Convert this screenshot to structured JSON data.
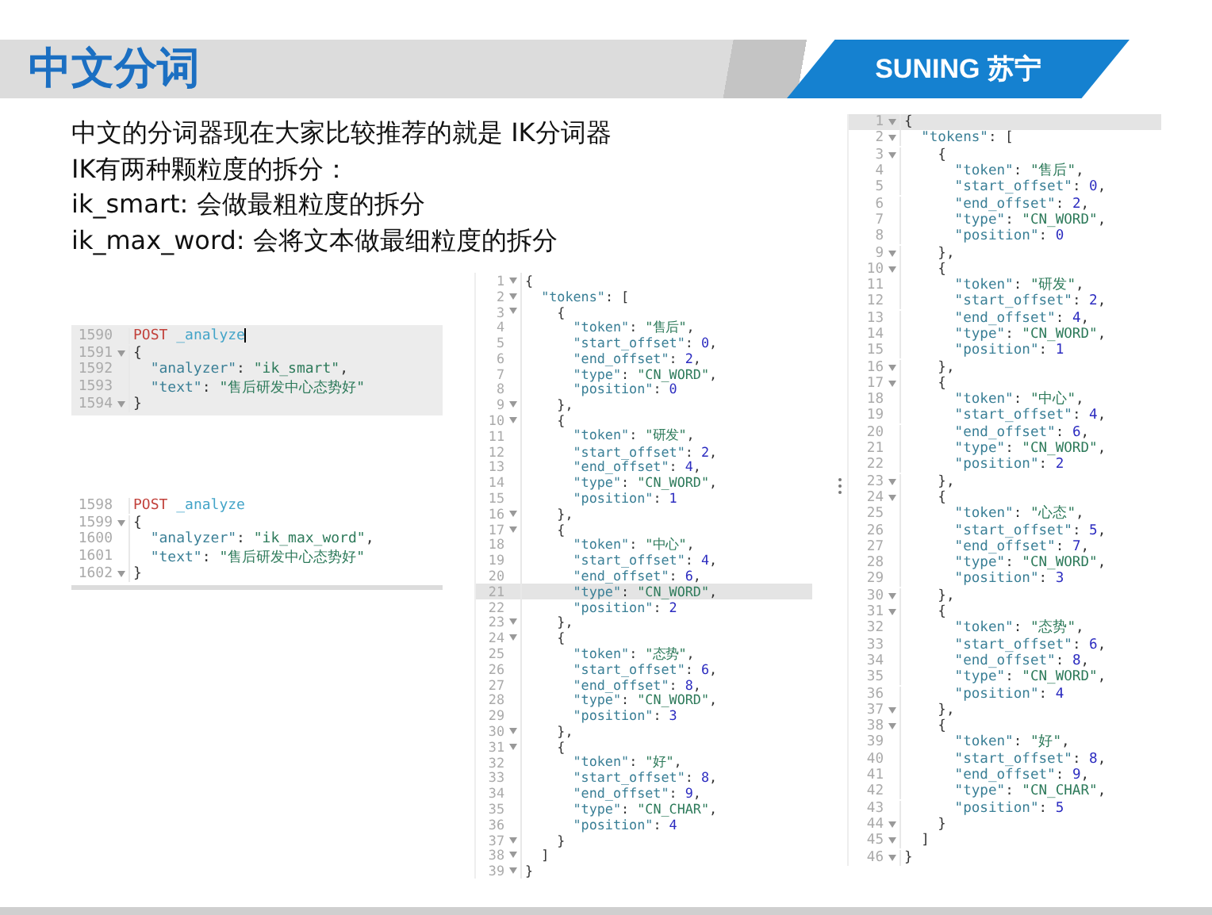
{
  "header": {
    "title": "中文分词",
    "logo": "SUNING 苏宁"
  },
  "intro": [
    "中文的分词器现在大家比较推荐的就是 IK分词器",
    "IK有两种颗粒度的拆分：",
    "ik_smart: 会做最粗粒度的拆分",
    "ik_max_word: 会将文本做最细粒度的拆分"
  ],
  "requests": [
    {
      "selected": true,
      "lines": [
        {
          "number": "1590",
          "text": "POST _analyze",
          "fold": false,
          "cursor": true
        },
        {
          "number": "1591",
          "text": "{",
          "fold": true,
          "cursor": false
        },
        {
          "number": "1592",
          "text": "  \"analyzer\": \"ik_smart\",",
          "fold": false,
          "cursor": false
        },
        {
          "number": "1593",
          "text": "  \"text\": \"售后研发中心态势好\"",
          "fold": false,
          "cursor": false
        },
        {
          "number": "1594",
          "text": "}",
          "fold": true,
          "cursor": false
        }
      ]
    },
    {
      "selected": false,
      "lines": [
        {
          "number": "1598",
          "text": "POST _analyze",
          "fold": false,
          "cursor": false
        },
        {
          "number": "1599",
          "text": "{",
          "fold": true,
          "cursor": false
        },
        {
          "number": "1600",
          "text": "  \"analyzer\": \"ik_max_word\",",
          "fold": false,
          "cursor": false
        },
        {
          "number": "1601",
          "text": "  \"text\": \"售后研发中心态势好\"",
          "fold": false,
          "cursor": false
        },
        {
          "number": "1602",
          "text": "}",
          "fold": true,
          "cursor": false
        }
      ]
    }
  ],
  "responses": [
    {
      "lines": [
        {
          "number": "1",
          "text": "{",
          "fold": true,
          "highlighted": false
        },
        {
          "number": "2",
          "text": "  \"tokens\": [",
          "fold": true,
          "highlighted": false
        },
        {
          "number": "3",
          "text": "    {",
          "fold": true,
          "highlighted": false
        },
        {
          "number": "4",
          "text": "      \"token\": \"售后\",",
          "fold": false,
          "highlighted": false
        },
        {
          "number": "5",
          "text": "      \"start_offset\": 0,",
          "fold": false,
          "highlighted": false
        },
        {
          "number": "6",
          "text": "      \"end_offset\": 2,",
          "fold": false,
          "highlighted": false
        },
        {
          "number": "7",
          "text": "      \"type\": \"CN_WORD\",",
          "fold": false,
          "highlighted": false
        },
        {
          "number": "8",
          "text": "      \"position\": 0",
          "fold": false,
          "highlighted": false
        },
        {
          "number": "9",
          "text": "    },",
          "fold": true,
          "highlighted": false
        },
        {
          "number": "10",
          "text": "    {",
          "fold": true,
          "highlighted": false
        },
        {
          "number": "11",
          "text": "      \"token\": \"研发\",",
          "fold": false,
          "highlighted": false
        },
        {
          "number": "12",
          "text": "      \"start_offset\": 2,",
          "fold": false,
          "highlighted": false
        },
        {
          "number": "13",
          "text": "      \"end_offset\": 4,",
          "fold": false,
          "highlighted": false
        },
        {
          "number": "14",
          "text": "      \"type\": \"CN_WORD\",",
          "fold": false,
          "highlighted": false
        },
        {
          "number": "15",
          "text": "      \"position\": 1",
          "fold": false,
          "highlighted": false
        },
        {
          "number": "16",
          "text": "    },",
          "fold": true,
          "highlighted": false
        },
        {
          "number": "17",
          "text": "    {",
          "fold": true,
          "highlighted": false
        },
        {
          "number": "18",
          "text": "      \"token\": \"中心\",",
          "fold": false,
          "highlighted": false
        },
        {
          "number": "19",
          "text": "      \"start_offset\": 4,",
          "fold": false,
          "highlighted": false
        },
        {
          "number": "20",
          "text": "      \"end_offset\": 6,",
          "fold": false,
          "highlighted": false
        },
        {
          "number": "21",
          "text": "      \"type\": \"CN_WORD\",",
          "fold": false,
          "highlighted": true
        },
        {
          "number": "22",
          "text": "      \"position\": 2",
          "fold": false,
          "highlighted": false
        },
        {
          "number": "23",
          "text": "    },",
          "fold": true,
          "highlighted": false
        },
        {
          "number": "24",
          "text": "    {",
          "fold": true,
          "highlighted": false
        },
        {
          "number": "25",
          "text": "      \"token\": \"态势\",",
          "fold": false,
          "highlighted": false
        },
        {
          "number": "26",
          "text": "      \"start_offset\": 6,",
          "fold": false,
          "highlighted": false
        },
        {
          "number": "27",
          "text": "      \"end_offset\": 8,",
          "fold": false,
          "highlighted": false
        },
        {
          "number": "28",
          "text": "      \"type\": \"CN_WORD\",",
          "fold": false,
          "highlighted": false
        },
        {
          "number": "29",
          "text": "      \"position\": 3",
          "fold": false,
          "highlighted": false
        },
        {
          "number": "30",
          "text": "    },",
          "fold": true,
          "highlighted": false
        },
        {
          "number": "31",
          "text": "    {",
          "fold": true,
          "highlighted": false
        },
        {
          "number": "32",
          "text": "      \"token\": \"好\",",
          "fold": false,
          "highlighted": false
        },
        {
          "number": "33",
          "text": "      \"start_offset\": 8,",
          "fold": false,
          "highlighted": false
        },
        {
          "number": "34",
          "text": "      \"end_offset\": 9,",
          "fold": false,
          "highlighted": false
        },
        {
          "number": "35",
          "text": "      \"type\": \"CN_CHAR\",",
          "fold": false,
          "highlighted": false
        },
        {
          "number": "36",
          "text": "      \"position\": 4",
          "fold": false,
          "highlighted": false
        },
        {
          "number": "37",
          "text": "    }",
          "fold": true,
          "highlighted": false
        },
        {
          "number": "38",
          "text": "  ]",
          "fold": true,
          "highlighted": false
        },
        {
          "number": "39",
          "text": "}",
          "fold": true,
          "highlighted": false
        }
      ]
    },
    {
      "lines": [
        {
          "number": "1",
          "text": "{",
          "fold": true,
          "highlighted": true
        },
        {
          "number": "2",
          "text": "  \"tokens\": [",
          "fold": true,
          "highlighted": false
        },
        {
          "number": "3",
          "text": "    {",
          "fold": true,
          "highlighted": false
        },
        {
          "number": "4",
          "text": "      \"token\": \"售后\",",
          "fold": false,
          "highlighted": false
        },
        {
          "number": "5",
          "text": "      \"start_offset\": 0,",
          "fold": false,
          "highlighted": false
        },
        {
          "number": "6",
          "text": "      \"end_offset\": 2,",
          "fold": false,
          "highlighted": false
        },
        {
          "number": "7",
          "text": "      \"type\": \"CN_WORD\",",
          "fold": false,
          "highlighted": false
        },
        {
          "number": "8",
          "text": "      \"position\": 0",
          "fold": false,
          "highlighted": false
        },
        {
          "number": "9",
          "text": "    },",
          "fold": true,
          "highlighted": false
        },
        {
          "number": "10",
          "text": "    {",
          "fold": true,
          "highlighted": false
        },
        {
          "number": "11",
          "text": "      \"token\": \"研发\",",
          "fold": false,
          "highlighted": false
        },
        {
          "number": "12",
          "text": "      \"start_offset\": 2,",
          "fold": false,
          "highlighted": false
        },
        {
          "number": "13",
          "text": "      \"end_offset\": 4,",
          "fold": false,
          "highlighted": false
        },
        {
          "number": "14",
          "text": "      \"type\": \"CN_WORD\",",
          "fold": false,
          "highlighted": false
        },
        {
          "number": "15",
          "text": "      \"position\": 1",
          "fold": false,
          "highlighted": false
        },
        {
          "number": "16",
          "text": "    },",
          "fold": true,
          "highlighted": false
        },
        {
          "number": "17",
          "text": "    {",
          "fold": true,
          "highlighted": false
        },
        {
          "number": "18",
          "text": "      \"token\": \"中心\",",
          "fold": false,
          "highlighted": false
        },
        {
          "number": "19",
          "text": "      \"start_offset\": 4,",
          "fold": false,
          "highlighted": false
        },
        {
          "number": "20",
          "text": "      \"end_offset\": 6,",
          "fold": false,
          "highlighted": false
        },
        {
          "number": "21",
          "text": "      \"type\": \"CN_WORD\",",
          "fold": false,
          "highlighted": false
        },
        {
          "number": "22",
          "text": "      \"position\": 2",
          "fold": false,
          "highlighted": false
        },
        {
          "number": "23",
          "text": "    },",
          "fold": true,
          "highlighted": false
        },
        {
          "number": "24",
          "text": "    {",
          "fold": true,
          "highlighted": false
        },
        {
          "number": "25",
          "text": "      \"token\": \"心态\",",
          "fold": false,
          "highlighted": false
        },
        {
          "number": "26",
          "text": "      \"start_offset\": 5,",
          "fold": false,
          "highlighted": false
        },
        {
          "number": "27",
          "text": "      \"end_offset\": 7,",
          "fold": false,
          "highlighted": false
        },
        {
          "number": "28",
          "text": "      \"type\": \"CN_WORD\",",
          "fold": false,
          "highlighted": false
        },
        {
          "number": "29",
          "text": "      \"position\": 3",
          "fold": false,
          "highlighted": false
        },
        {
          "number": "30",
          "text": "    },",
          "fold": true,
          "highlighted": false
        },
        {
          "number": "31",
          "text": "    {",
          "fold": true,
          "highlighted": false
        },
        {
          "number": "32",
          "text": "      \"token\": \"态势\",",
          "fold": false,
          "highlighted": false
        },
        {
          "number": "33",
          "text": "      \"start_offset\": 6,",
          "fold": false,
          "highlighted": false
        },
        {
          "number": "34",
          "text": "      \"end_offset\": 8,",
          "fold": false,
          "highlighted": false
        },
        {
          "number": "35",
          "text": "      \"type\": \"CN_WORD\",",
          "fold": false,
          "highlighted": false
        },
        {
          "number": "36",
          "text": "      \"position\": 4",
          "fold": false,
          "highlighted": false
        },
        {
          "number": "37",
          "text": "    },",
          "fold": true,
          "highlighted": false
        },
        {
          "number": "38",
          "text": "    {",
          "fold": true,
          "highlighted": false
        },
        {
          "number": "39",
          "text": "      \"token\": \"好\",",
          "fold": false,
          "highlighted": false
        },
        {
          "number": "40",
          "text": "      \"start_offset\": 8,",
          "fold": false,
          "highlighted": false
        },
        {
          "number": "41",
          "text": "      \"end_offset\": 9,",
          "fold": false,
          "highlighted": false
        },
        {
          "number": "42",
          "text": "      \"type\": \"CN_CHAR\",",
          "fold": false,
          "highlighted": false
        },
        {
          "number": "43",
          "text": "      \"position\": 5",
          "fold": false,
          "highlighted": false
        },
        {
          "number": "44",
          "text": "    }",
          "fold": true,
          "highlighted": false
        },
        {
          "number": "45",
          "text": "  ]",
          "fold": true,
          "highlighted": false
        },
        {
          "number": "46",
          "text": "}",
          "fold": true,
          "highlighted": false
        }
      ]
    }
  ]
}
